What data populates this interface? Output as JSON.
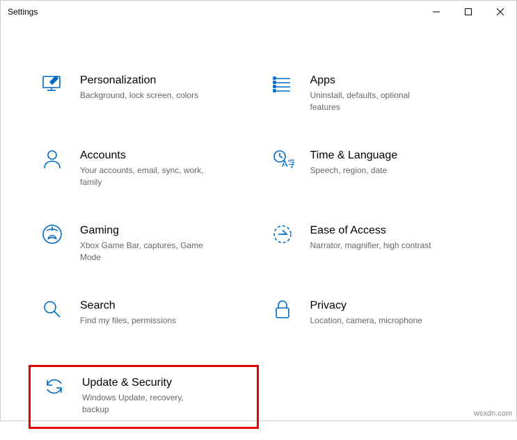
{
  "window": {
    "title": "Settings"
  },
  "tiles": {
    "personalization": {
      "title": "Personalization",
      "desc": "Background, lock screen, colors"
    },
    "apps": {
      "title": "Apps",
      "desc": "Uninstall, defaults, optional features"
    },
    "accounts": {
      "title": "Accounts",
      "desc": "Your accounts, email, sync, work, family"
    },
    "time": {
      "title": "Time & Language",
      "desc": "Speech, region, date"
    },
    "gaming": {
      "title": "Gaming",
      "desc": "Xbox Game Bar, captures, Game Mode"
    },
    "ease": {
      "title": "Ease of Access",
      "desc": "Narrator, magnifier, high contrast"
    },
    "search": {
      "title": "Search",
      "desc": "Find my files, permissions"
    },
    "privacy": {
      "title": "Privacy",
      "desc": "Location, camera, microphone"
    },
    "update": {
      "title": "Update & Security",
      "desc": "Windows Update, recovery, backup"
    }
  },
  "watermark": "wsxdn.com"
}
